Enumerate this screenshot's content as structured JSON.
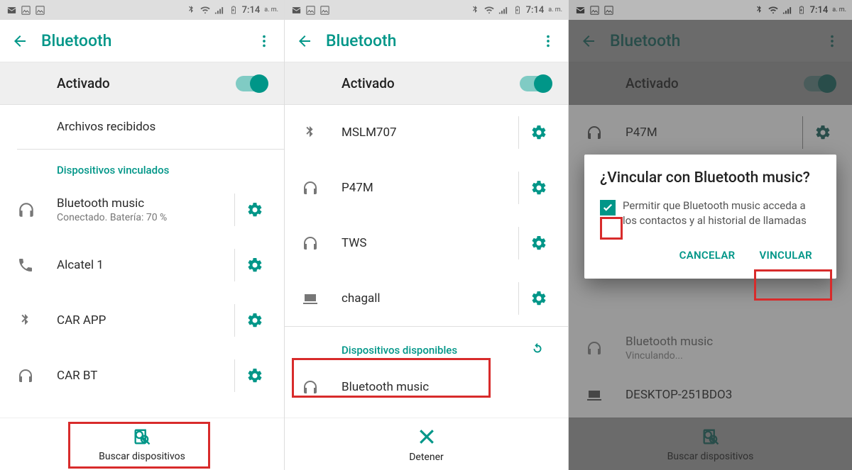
{
  "statusbar": {
    "time": "7:14",
    "time_suffix": "a. m."
  },
  "appbar": {
    "title": "Bluetooth"
  },
  "panel1": {
    "toggle_label": "Activado",
    "received_files": "Archivos recibidos",
    "paired_header": "Dispositivos vinculados",
    "devices": [
      {
        "icon": "headphones",
        "name": "Bluetooth music",
        "status": "Conectado. Batería: 70 %"
      },
      {
        "icon": "phone",
        "name": "Alcatel 1"
      },
      {
        "icon": "bluetooth",
        "name": "CAR APP"
      },
      {
        "icon": "headphones",
        "name": "CAR BT"
      }
    ],
    "bottom_label": "Buscar dispositivos"
  },
  "panel2": {
    "toggle_label": "Activado",
    "devices": [
      {
        "icon": "bluetooth",
        "name": "MSLM707"
      },
      {
        "icon": "headphones",
        "name": "P47M"
      },
      {
        "icon": "headphones",
        "name": "TWS"
      },
      {
        "icon": "laptop",
        "name": "chagall"
      }
    ],
    "available_header": "Dispositivos disponibles",
    "available_item": "Bluetooth music",
    "bottom_label": "Detener"
  },
  "panel3": {
    "toggle_label": "Activado",
    "devices": [
      {
        "icon": "headphones",
        "name": "P47M"
      }
    ],
    "linking_name": "Bluetooth music",
    "linking_status": "Vinculando...",
    "desktop": "DESKTOP-251BDO3",
    "dialog": {
      "title": "¿Vincular con Bluetooth music?",
      "permission": "Permitir que Bluetooth music acceda a los contactos y al historial de llamadas",
      "cancel": "CANCELAR",
      "pair": "VINCULAR"
    },
    "bottom_label": "Buscar dispositivos"
  }
}
